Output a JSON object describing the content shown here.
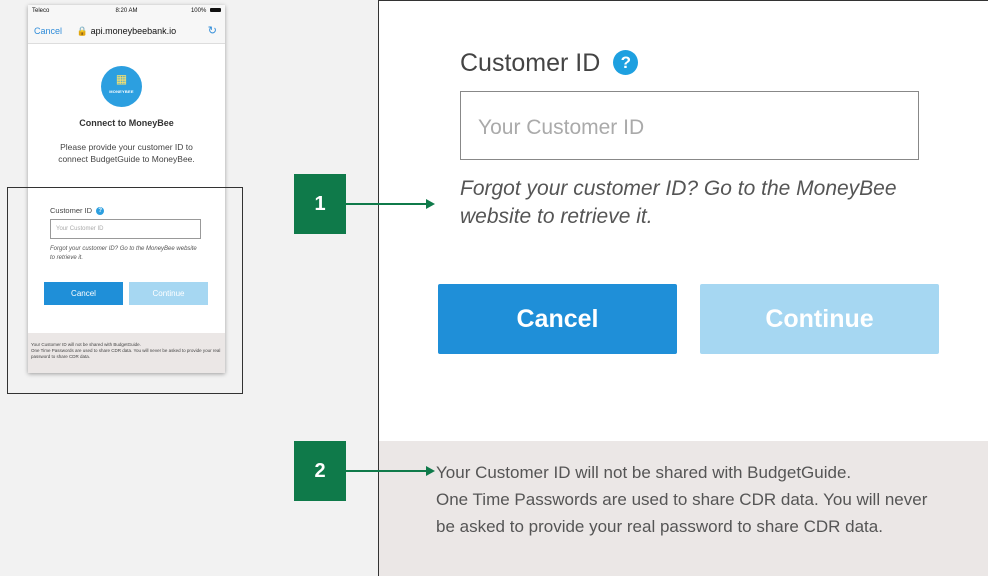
{
  "status_bar": {
    "carrier": "Teleco",
    "time": "8:20 AM",
    "battery": "100%"
  },
  "browser": {
    "cancel_label": "Cancel",
    "url": "api.moneybeebank.io"
  },
  "logo": {
    "text": "MONEYBEE"
  },
  "connect": {
    "title": "Connect to MoneyBee",
    "description": "Please provide your customer ID to connect BudgetGuide to MoneyBee."
  },
  "form": {
    "label": "Customer ID",
    "placeholder": "Your Customer ID",
    "forgot_text": "Forgot your customer ID? Go to the MoneyBee website to retrieve it.",
    "cancel_label": "Cancel",
    "continue_label": "Continue"
  },
  "footer": {
    "line1": "Your Customer ID will not be shared with BudgetGuide.",
    "line2": "One Time Passwords are used to share CDR data. You will never be asked to provide your real password to share CDR data.",
    "line2a": "One Time Passwords are used to share CDR data. You will never",
    "line2b": "be asked to provide your real password to share CDR data."
  },
  "callouts": {
    "one": "1",
    "two": "2"
  },
  "colors": {
    "primary_blue": "#1f8fd8",
    "disabled_blue": "#a6d7f2",
    "callout_green": "#0f7a4a",
    "footer_bg": "#ebe7e6"
  }
}
